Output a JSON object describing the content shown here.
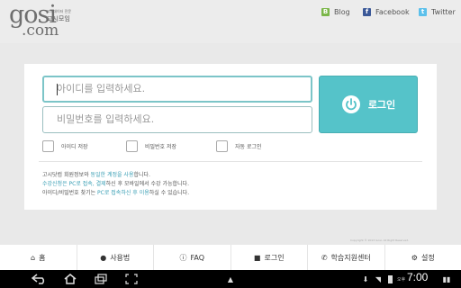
{
  "header": {
    "logo_main": "gosi",
    "logo_com": ".com",
    "logo_tagline": "고시데이터 전문",
    "logo_brand": "고시모임",
    "social": [
      {
        "label": "Blog",
        "icon": "blog-icon"
      },
      {
        "label": "Facebook",
        "icon": "facebook-icon"
      },
      {
        "label": "Twitter",
        "icon": "twitter-icon"
      }
    ]
  },
  "login": {
    "id_placeholder": "아이디를 입력하세요.",
    "pw_placeholder": "비밀번호를 입력하세요.",
    "button_label": "로그인",
    "checkboxes": [
      {
        "label": "아이디 저장",
        "checked": false
      },
      {
        "label": "비밀번호 저장",
        "checked": false
      },
      {
        "label": "자동 로그인",
        "checked": false
      }
    ]
  },
  "notes": {
    "line1_a": "고시닷컴 회원정보와 ",
    "line1_hl": "동일한 계정을 사용",
    "line1_b": "합니다.",
    "line2_hl": "수강신청은 PC로 접속, 결제",
    "line2_b": "하신 후 모바일에서 수강 가능합니다.",
    "line3_a": "아이디/비밀번호 찾기는 ",
    "line3_hl": "PC로 접속하신 후 이용",
    "line3_b": "하실 수 있습니다."
  },
  "copyright": "Copyright © 2013 Gosi. All Right Reserved.",
  "bottom_nav": [
    {
      "label": "홈",
      "icon": "home-icon"
    },
    {
      "label": "사용법",
      "icon": "chat-icon"
    },
    {
      "label": "FAQ",
      "icon": "info-icon"
    },
    {
      "label": "로그인",
      "icon": "lock-icon"
    },
    {
      "label": "학습지원센터",
      "icon": "phone-icon"
    },
    {
      "label": "설정",
      "icon": "gear-icon"
    }
  ],
  "system_bar": {
    "ampm": "오후",
    "time": "7:00"
  },
  "colors": {
    "accent": "#55c3c9",
    "highlight_text": "#3a9fb5",
    "background": "#e9e9e9"
  }
}
